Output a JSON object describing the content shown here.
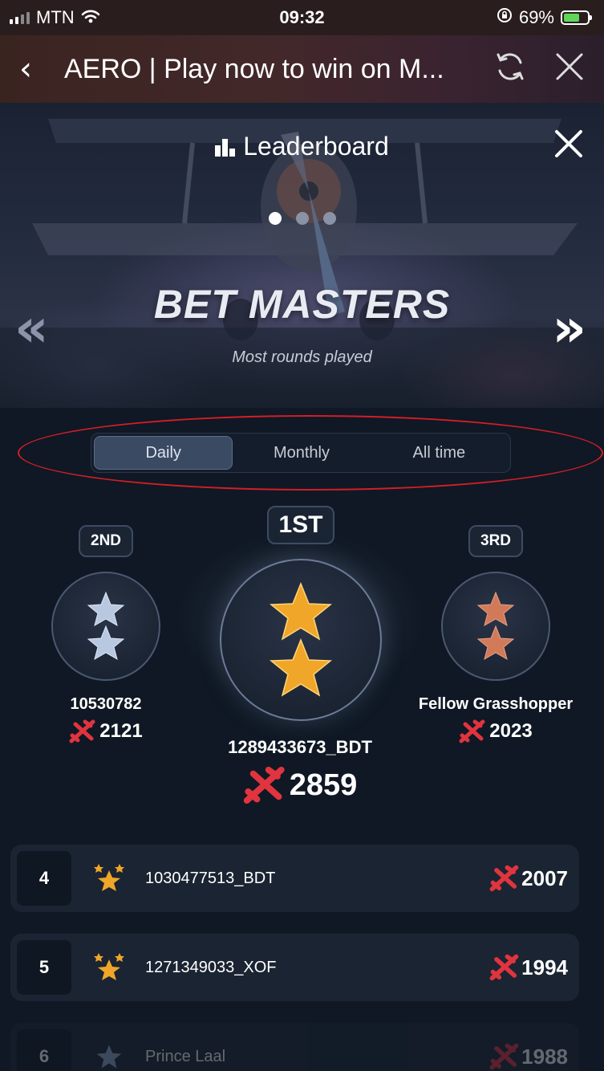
{
  "status_bar": {
    "carrier": "MTN",
    "time": "09:32",
    "battery": "69%",
    "battery_level": 0.69
  },
  "nav_bar": {
    "title": "AERO | Play now to win on M...",
    "icons": [
      "back-chevron-icon",
      "refresh-icon",
      "close-icon"
    ]
  },
  "hero": {
    "title": "Leaderboard",
    "heading": "BET MASTERS",
    "subtitle": "Most rounds played",
    "carousel_pages": 3,
    "active_page": 1
  },
  "tabs": {
    "items": [
      "Daily",
      "Monthly",
      "All time"
    ],
    "active": "Daily"
  },
  "podium": {
    "first": {
      "rank": "1ST",
      "name": "1289433673_BDT",
      "score": "2859"
    },
    "second": {
      "rank": "2ND",
      "name": "10530782",
      "score": "2121"
    },
    "third": {
      "rank": "3RD",
      "name": "Fellow Grasshopper",
      "score": "2023"
    }
  },
  "list": [
    {
      "rank": "4",
      "name": "1030477513_BDT",
      "score": "2007"
    },
    {
      "rank": "5",
      "name": "1271349033_XOF",
      "score": "1994"
    },
    {
      "rank": "6",
      "name": "Prince Laal",
      "score": "1988"
    }
  ],
  "colors": {
    "accent_red": "#d21e27",
    "plane_red": "#e0343f",
    "gold_star": "#f0a629",
    "silver_star": "#b8c8e0",
    "bronze_star": "#d07a5a"
  }
}
